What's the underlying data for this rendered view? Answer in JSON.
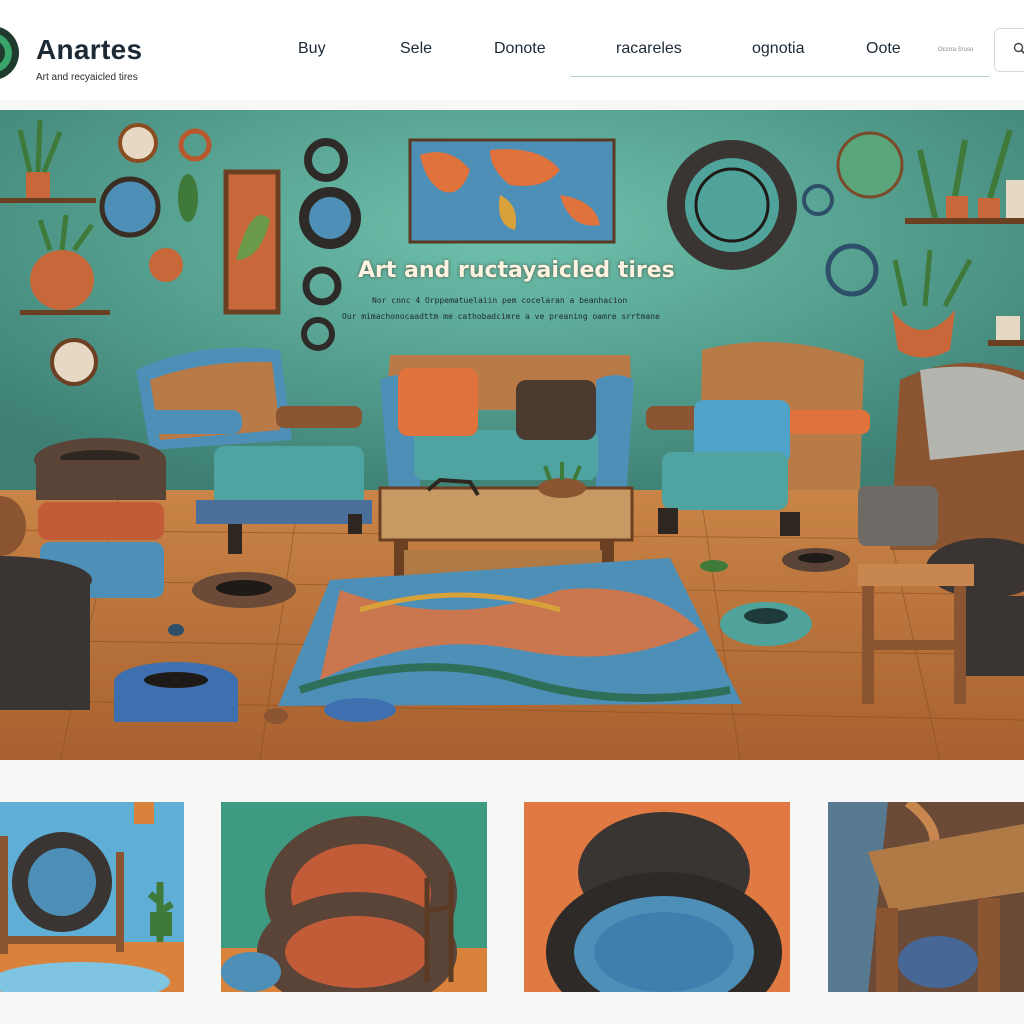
{
  "brand": {
    "name": "Anartes",
    "tagline": "Art and recyaicled tires"
  },
  "nav": {
    "items": [
      {
        "label": "Buy"
      },
      {
        "label": "Sele"
      },
      {
        "label": "Donote"
      },
      {
        "label": "racareles"
      },
      {
        "label": "ognotia"
      },
      {
        "label": "Oote"
      }
    ]
  },
  "search": {
    "caption": "Ocsrra Sruso"
  },
  "hero": {
    "title": "Art and ructayaicled tires",
    "subtitle_line1": "Nor cnnc 4 Orppematuelaiin pem cocelaran a beanhacion",
    "subtitle_line2": "Our mimachonocaadttm me cathobadcimre a ve preaning oamre srrtmane"
  },
  "colors": {
    "wall": "#4f9a8a",
    "floor": "#b8723c",
    "tire": "#3a3532",
    "accent_orange": "#e0733c",
    "accent_blue": "#4fa3c9"
  },
  "gallery": {
    "items": [
      {
        "icon": "tire-stand-icon"
      },
      {
        "icon": "stacked-tires-icon"
      },
      {
        "icon": "tire-planter-icon"
      },
      {
        "icon": "wood-table-icon"
      }
    ]
  }
}
